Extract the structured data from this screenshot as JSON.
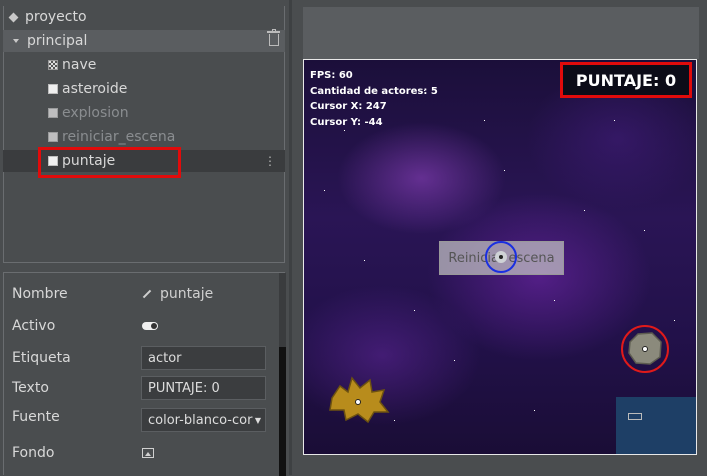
{
  "tree": {
    "root_label": "proyecto",
    "scene_label": "principal",
    "actors": [
      {
        "label": "nave",
        "active": true,
        "icon": "image-checkbox"
      },
      {
        "label": "asteroide",
        "active": true,
        "icon": "checkbox"
      },
      {
        "label": "explosion",
        "active": false,
        "icon": "checkbox"
      },
      {
        "label": "reiniciar_escena",
        "active": false,
        "icon": "checkbox"
      },
      {
        "label": "puntaje",
        "active": true,
        "icon": "checkbox",
        "selected": true
      }
    ],
    "more_glyph": "⋮"
  },
  "properties": {
    "nombre": {
      "label": "Nombre",
      "value": "puntaje"
    },
    "activo": {
      "label": "Activo",
      "value": true
    },
    "etiqueta": {
      "label": "Etiqueta",
      "value": "actor"
    },
    "texto": {
      "label": "Texto",
      "value": "PUNTAJE: 0"
    },
    "fuente": {
      "label": "Fuente",
      "value": "color-blanco-cor",
      "arrow": "▼"
    },
    "fondo": {
      "label": "Fondo"
    }
  },
  "game": {
    "debug": {
      "fps": "FPS: 60",
      "actors": "Cantidad de actores: 5",
      "cursor_x": "Cursor X: 247",
      "cursor_y": "Cursor Y: -44"
    },
    "score_text": "PUNTAJE: 0",
    "restart_label": "Reiniciar escena"
  },
  "colors": {
    "highlight": "#e10b0b",
    "panel_bg": "#4a4d4f",
    "space_bg": "#22114a"
  }
}
